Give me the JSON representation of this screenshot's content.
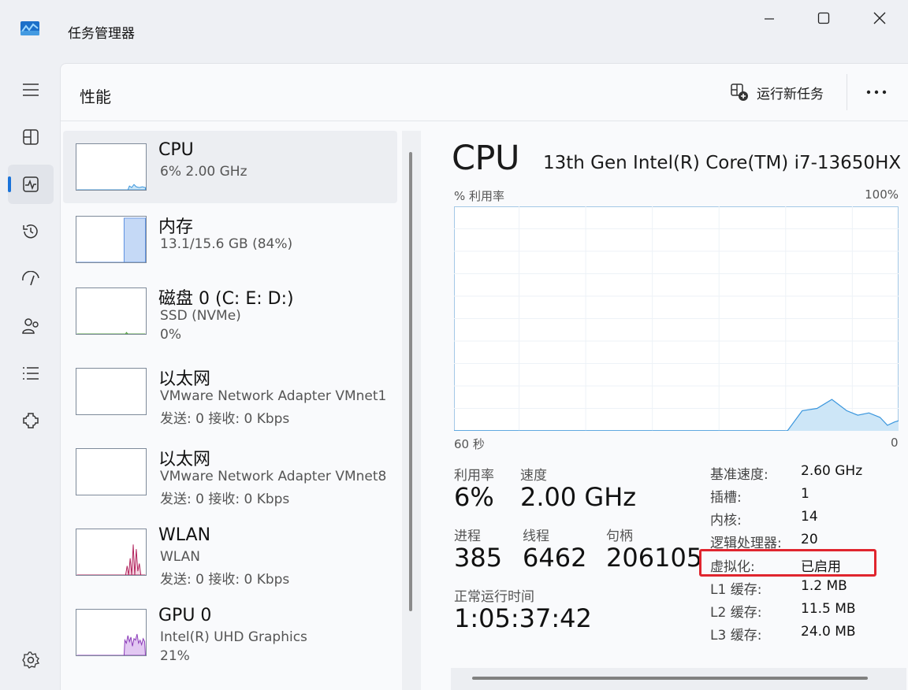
{
  "window": {
    "title": "任务管理器"
  },
  "header": {
    "page_title": "性能",
    "run_task_label": "运行新任务"
  },
  "rail": [
    "menu-icon",
    "processes-icon",
    "performance-icon",
    "history-icon",
    "startup-icon",
    "users-icon",
    "details-icon",
    "services-icon",
    "settings-icon"
  ],
  "devices": [
    {
      "name": "CPU",
      "line1": "6%  2.00 GHz",
      "line2": "",
      "graph_color": "#3a96dd",
      "fill": "#cde6f7"
    },
    {
      "name": "内存",
      "line1": "13.1/15.6 GB (84%)",
      "line2": "",
      "graph_color": "#5b8fe0",
      "fill": "#c5d9f6"
    },
    {
      "name": "磁盘 0 (C: E: D:)",
      "line1": "SSD (NVMe)",
      "line2": "0%",
      "graph_color": "#4a9a37",
      "fill": "#e6f2e1"
    },
    {
      "name": "以太网",
      "line1": "VMware Network Adapter VMnet1",
      "line2": "发送: 0  接收: 0 Kbps",
      "graph_color": "#a74f00",
      "fill": "#ffffff"
    },
    {
      "name": "以太网",
      "line1": "VMware Network Adapter VMnet8",
      "line2": "发送: 0  接收: 0 Kbps",
      "graph_color": "#a74f00",
      "fill": "#ffffff"
    },
    {
      "name": "WLAN",
      "line1": "WLAN",
      "line2": "发送: 0  接收: 0 Kbps",
      "graph_color": "#b0205a",
      "fill": "#f5d6e2"
    },
    {
      "name": "GPU 0",
      "line1": "Intel(R) UHD Graphics",
      "line2": "21%",
      "graph_color": "#8a3ab8",
      "fill": "#e2c8f2"
    }
  ],
  "detail": {
    "title": "CPU",
    "model": "13th Gen Intel(R) Core(TM) i7-13650HX",
    "y_label": "% 利用率",
    "y_max_label": "100%",
    "x_left_label": "60 秒",
    "x_right_label": "0",
    "utilization_label": "利用率",
    "utilization": "6%",
    "speed_label": "速度",
    "speed": "2.00 GHz",
    "processes_label": "进程",
    "processes": "385",
    "threads_label": "线程",
    "threads": "6462",
    "handles_label": "句柄",
    "handles": "206105",
    "uptime_label": "正常运行时间",
    "uptime": "1:05:37:42",
    "specs": [
      {
        "k": "基准速度:",
        "v": "2.60 GHz"
      },
      {
        "k": "插槽:",
        "v": "1"
      },
      {
        "k": "内核:",
        "v": "14"
      },
      {
        "k": "逻辑处理器:",
        "v": "20"
      },
      {
        "k": "虚拟化:",
        "v": "已启用"
      },
      {
        "k": "L1 缓存:",
        "v": "1.2 MB"
      },
      {
        "k": "L2 缓存:",
        "v": "11.5 MB"
      },
      {
        "k": "L3 缓存:",
        "v": "24.0 MB"
      }
    ],
    "highlight_color": "#e0252e"
  },
  "chart_data": {
    "type": "area",
    "title": "",
    "xlabel": "60 秒",
    "ylabel": "% 利用率",
    "ylim": [
      0,
      100
    ],
    "x": [
      60,
      57,
      54,
      51,
      48,
      45,
      42,
      39,
      36,
      33,
      30,
      27,
      24,
      21,
      18,
      15,
      12,
      9,
      6,
      3,
      0
    ],
    "series": [
      {
        "values": [
          0,
          0,
          0,
          0,
          0,
          0,
          0,
          0,
          0,
          0,
          0,
          0,
          0,
          0,
          0,
          5,
          12,
          9,
          8,
          6,
          6
        ]
      }
    ],
    "points": [
      [
        60,
        0
      ],
      [
        15,
        0
      ],
      [
        13,
        9
      ],
      [
        11,
        10
      ],
      [
        9,
        14
      ],
      [
        7,
        9
      ],
      [
        5.5,
        7
      ],
      [
        4,
        8
      ],
      [
        2.5,
        6
      ],
      [
        1.5,
        2.5
      ],
      [
        0.5,
        4
      ],
      [
        0,
        4.5
      ]
    ],
    "grid": true,
    "color": "#3a96dd",
    "fill": "#cde6f7"
  }
}
